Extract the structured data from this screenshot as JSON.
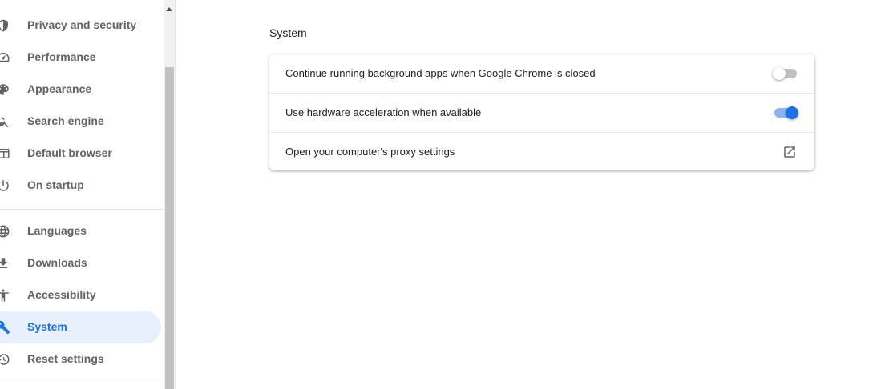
{
  "sidebar": {
    "items": [
      {
        "label": "Privacy and security",
        "icon": "shield-icon"
      },
      {
        "label": "Performance",
        "icon": "speedometer-icon"
      },
      {
        "label": "Appearance",
        "icon": "palette-icon"
      },
      {
        "label": "Search engine",
        "icon": "search-icon"
      },
      {
        "label": "Default browser",
        "icon": "browser-window-icon"
      },
      {
        "label": "On startup",
        "icon": "power-icon"
      },
      {
        "label": "Languages",
        "icon": "globe-icon"
      },
      {
        "label": "Downloads",
        "icon": "download-icon"
      },
      {
        "label": "Accessibility",
        "icon": "accessibility-icon"
      },
      {
        "label": "System",
        "icon": "wrench-icon",
        "active": true
      },
      {
        "label": "Reset settings",
        "icon": "history-icon"
      }
    ]
  },
  "main": {
    "section_title": "System",
    "rows": [
      {
        "label": "Continue running background apps when Google Chrome is closed",
        "control": "toggle",
        "checked": false
      },
      {
        "label": "Use hardware acceleration when available",
        "control": "toggle",
        "checked": true
      },
      {
        "label": "Open your computer's proxy settings",
        "control": "external-link",
        "icon": "open-in-new-icon"
      }
    ]
  },
  "colors": {
    "accent": "#1a73e8",
    "active_bg": "#e8f0fe",
    "text_secondary": "#5f6368"
  }
}
